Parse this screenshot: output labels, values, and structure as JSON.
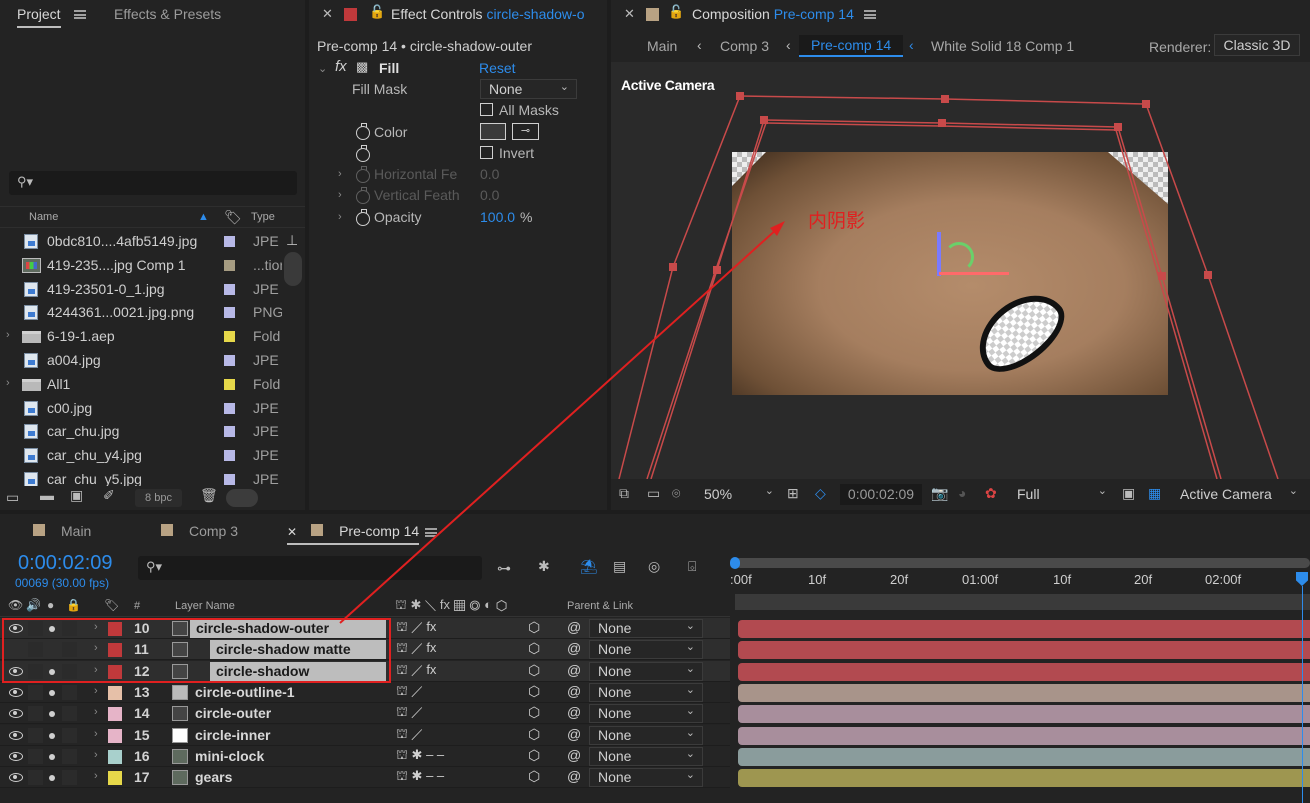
{
  "project": {
    "tab": "Project",
    "tab2": "Effects & Presets",
    "col_name": "Name",
    "col_type": "Type",
    "bpc": "8 bpc",
    "files": [
      {
        "name": "0bdc810....4afb5149.jpg",
        "type": "JPE",
        "kind": "file",
        "color": "#b7b8e6"
      },
      {
        "name": "419-235....jpg Comp 1",
        "type": "...tion",
        "kind": "comp",
        "color": "#a69c82"
      },
      {
        "name": "419-23501-0_1.jpg",
        "type": "JPE",
        "kind": "file",
        "color": "#b7b8e6"
      },
      {
        "name": "4244361...0021.jpg.png",
        "type": "PNG",
        "kind": "file",
        "color": "#b7b8e6"
      },
      {
        "name": "6-19-1.aep",
        "type": "Fold",
        "kind": "folder",
        "color": "#e6d84a"
      },
      {
        "name": "a004.jpg",
        "type": "JPE",
        "kind": "file",
        "color": "#b7b8e6"
      },
      {
        "name": "All1",
        "type": "Fold",
        "kind": "folder",
        "color": "#e6d84a"
      },
      {
        "name": "c00.jpg",
        "type": "JPE",
        "kind": "file",
        "color": "#b7b8e6"
      },
      {
        "name": "car_chu.jpg",
        "type": "JPE",
        "kind": "file",
        "color": "#b7b8e6"
      },
      {
        "name": "car_chu_y4.jpg",
        "type": "JPE",
        "kind": "file",
        "color": "#b7b8e6"
      },
      {
        "name": "car_chu_y5.jpg",
        "type": "JPE",
        "kind": "file",
        "color": "#b7b8e6"
      }
    ]
  },
  "effects": {
    "tab_prefix": "Effect Controls",
    "tab_layer": "circle-shadow-o",
    "header": "Pre-comp 14 • circle-shadow-outer",
    "fx_name": "Fill",
    "reset": "Reset",
    "fill_mask_label": "Fill Mask",
    "fill_mask_value": "None",
    "all_masks": "All Masks",
    "color_label": "Color",
    "invert": "Invert",
    "hfeather": "Horizontal Fe",
    "hfeather_val": "0.0",
    "vfeather": "Vertical Feath",
    "vfeather_val": "0.0",
    "opacity_label": "Opacity",
    "opacity_val": "100.0",
    "opacity_unit": "%"
  },
  "composition": {
    "tab_prefix": "Composition",
    "tab_comp": "Pre-comp 14",
    "breadcrumbs": [
      "Main",
      "Comp 3",
      "Pre-comp 14",
      "White Solid 18 Comp 1"
    ],
    "renderer_label": "Renderer:",
    "renderer": "Classic 3D",
    "camera_label": "Active Camera",
    "annotation": "内阴影",
    "zoom": "50%",
    "timecode": "0:00:02:09",
    "resolution": "Full",
    "view": "Active Camera"
  },
  "timeline": {
    "tabs": [
      "Main",
      "Comp 3",
      "Pre-comp 14"
    ],
    "timecode": "0:00:02:09",
    "frames": "00069 (30.00 fps)",
    "col_layer": "Layer Name",
    "col_num": "#",
    "col_parent": "Parent & Link",
    "ruler": [
      ":00f",
      "10f",
      "20f",
      "01:00f",
      "10f",
      "20f",
      "02:00f"
    ],
    "layers": [
      {
        "num": "10",
        "name": "circle-shadow-outer",
        "color": "#c0393b",
        "parent": "None",
        "bar": "#b24a50"
      },
      {
        "num": "11",
        "name": "circle-shadow matte",
        "color": "#c0393b",
        "parent": "None",
        "bar": "#b24a50"
      },
      {
        "num": "12",
        "name": "circle-shadow",
        "color": "#c0393b",
        "parent": "None",
        "bar": "#b24a50"
      },
      {
        "num": "13",
        "name": "circle-outline-1",
        "color": "#e6c0a8",
        "parent": "None",
        "bar": "#a8948a"
      },
      {
        "num": "14",
        "name": "circle-outer",
        "color": "#e6b4c8",
        "parent": "None",
        "bar": "#a88e9c"
      },
      {
        "num": "15",
        "name": "circle-inner",
        "color": "#e6b4c8",
        "parent": "None",
        "bar": "#a88e9c"
      },
      {
        "num": "16",
        "name": "mini-clock",
        "color": "#a8d0cc",
        "parent": "None",
        "bar": "#8a9c9c"
      },
      {
        "num": "17",
        "name": "gears",
        "color": "#e6d84a",
        "parent": "None",
        "bar": "#9e9650"
      }
    ]
  },
  "colors": {
    "accent": "#2d8ceb",
    "annotation": "#e02020"
  }
}
